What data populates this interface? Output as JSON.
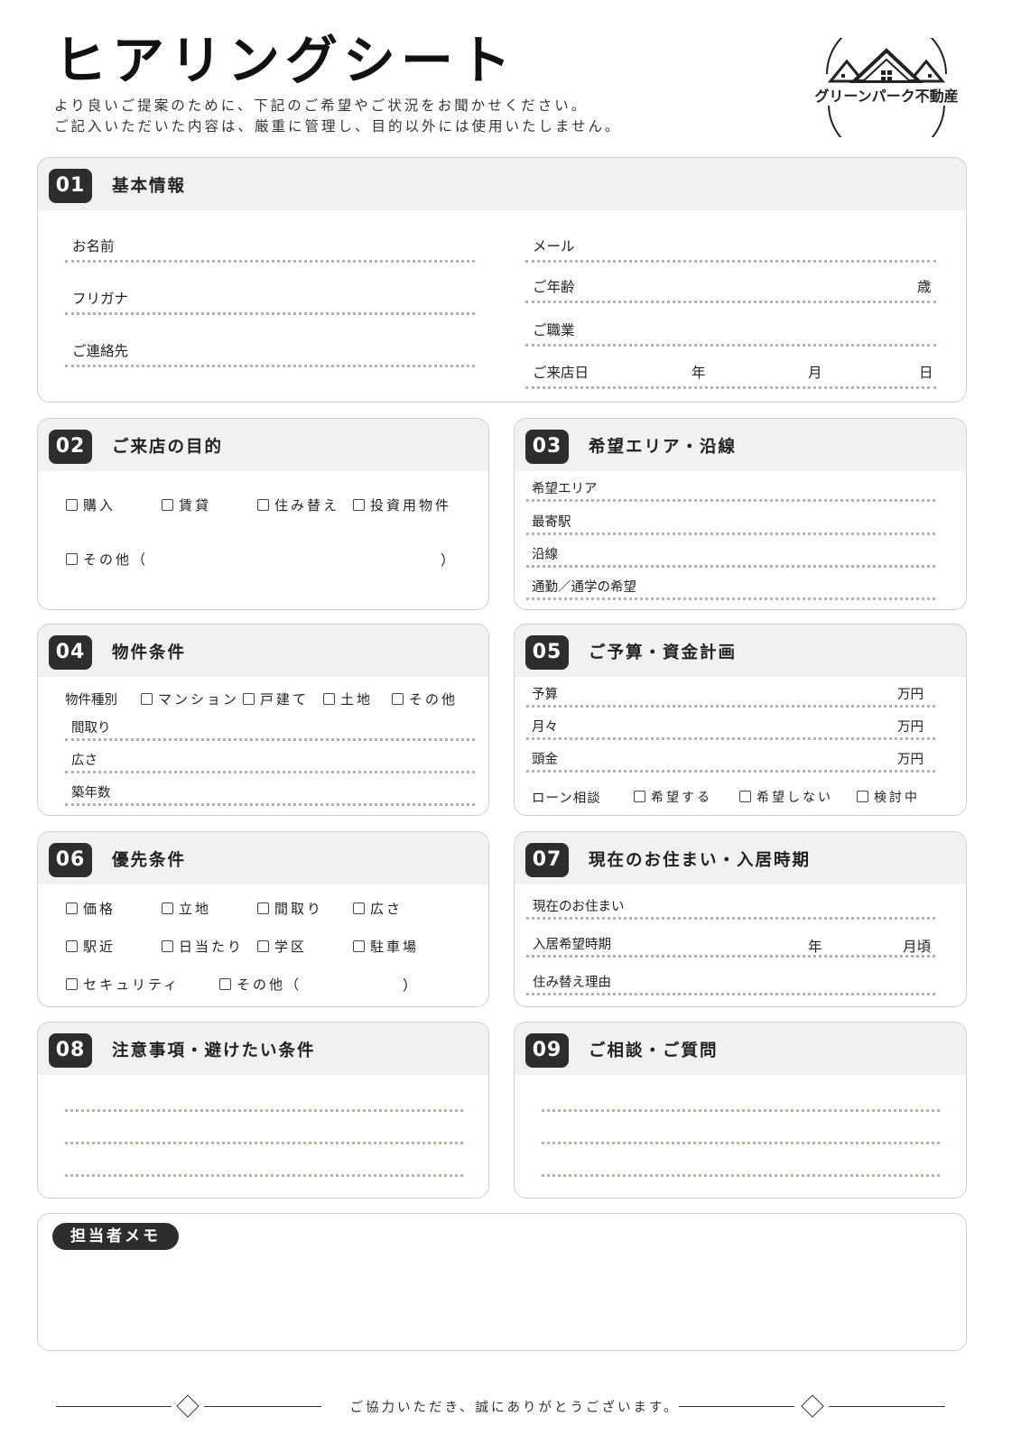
{
  "header": {
    "title": "ヒアリングシート",
    "subtitle_line1": "より良いご提案のために、下記のご希望やご状況をお聞かせください。",
    "subtitle_line2": "ご記入いただいた内容は、厳重に管理し、目的以外には使用いたしません。",
    "logo_text": "グリーンパーク不動産"
  },
  "s01": {
    "num": "01",
    "title": "基本情報",
    "name": "お名前",
    "furigana": "フリガナ",
    "contact": "ご連絡先",
    "email": "メール",
    "age": "ご年齢",
    "age_unit": "歳",
    "job": "ご職業",
    "visit": "ご来店日",
    "year": "年",
    "month": "月",
    "day": "日"
  },
  "s02": {
    "num": "02",
    "title": "ご来店の目的",
    "opt1": "購入",
    "opt2": "賃貸",
    "opt3": "住み替え",
    "opt4": "投資用物件",
    "other": "その他（",
    "close": "）"
  },
  "s03": {
    "num": "03",
    "title": "希望エリア・沿線",
    "area": "希望エリア",
    "station": "最寄駅",
    "line": "沿線",
    "commute": "通勤／通学の希望"
  },
  "s04": {
    "num": "04",
    "title": "物件条件",
    "type": "物件種別",
    "opt1": "マンション",
    "opt2": "戸建て",
    "opt3": "土地",
    "opt4": "その他",
    "layout": "間取り",
    "size": "広さ",
    "age": "築年数"
  },
  "s05": {
    "num": "05",
    "title": "ご予算・資金計画",
    "budget": "予算",
    "monthly": "月々",
    "down": "頭金",
    "unit": "万円",
    "loan": "ローン相談",
    "opt1": "希望する",
    "opt2": "希望しない",
    "opt3": "検討中"
  },
  "s06": {
    "num": "06",
    "title": "優先条件",
    "o1": "価格",
    "o2": "立地",
    "o3": "間取り",
    "o4": "広さ",
    "o5": "駅近",
    "o6": "日当たり",
    "o7": "学区",
    "o8": "駐車場",
    "o9": "セキュリティ",
    "o10": "その他（",
    "close": "）"
  },
  "s07": {
    "num": "07",
    "title": "現在のお住まい・入居時期",
    "current": "現在のお住まい",
    "move": "入居希望時期",
    "year": "年",
    "month": "月頃",
    "reason": "住み替え理由"
  },
  "s08": {
    "num": "08",
    "title": "注意事項・避けたい条件"
  },
  "s09": {
    "num": "09",
    "title": "ご相談・ご質問"
  },
  "memo": {
    "label": "担当者メモ"
  },
  "footer": {
    "text": "ご協力いただき、誠にありがとうございます。"
  }
}
